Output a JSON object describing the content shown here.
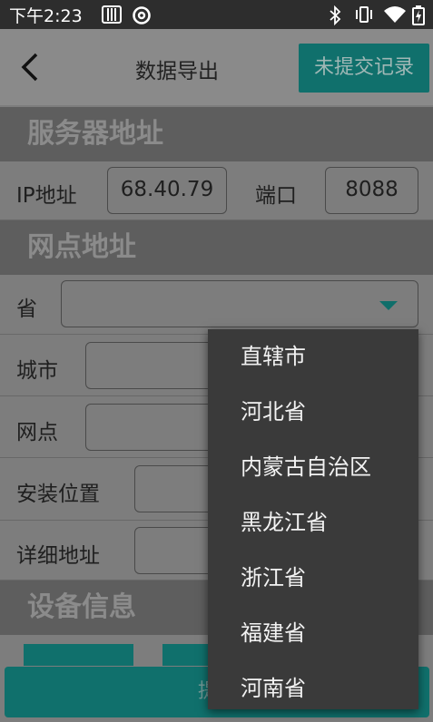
{
  "status_bar": {
    "time": "下午2:23",
    "icons": [
      "calendar-icon",
      "sync-icon",
      "bluetooth-icon",
      "vibrate-icon",
      "wifi-icon",
      "battery-charging-icon"
    ]
  },
  "app_bar": {
    "title": "数据导出",
    "back_icon": "back-arrow-icon",
    "unsubmitted_button": "未提交记录"
  },
  "sections": {
    "server": "服务器地址",
    "site": "网点地址",
    "device": "设备信息"
  },
  "server": {
    "ip_label": "IP地址",
    "ip_value": "68.40.79",
    "port_label": "端口",
    "port_value": "8088"
  },
  "site": {
    "province_label": "省",
    "city_label": "城市",
    "branch_label": "网点",
    "install_label": "安装位置",
    "detail_label": "详细地址"
  },
  "submit_button": "提",
  "province_menu": [
    "直辖市",
    "河北省",
    "内蒙古自治区",
    "黑龙江省",
    "浙江省",
    "福建省",
    "河南省"
  ],
  "colors": {
    "accent": "#10706c",
    "dim_background": "#7d7d7d",
    "menu_background": "#3a3a3a"
  }
}
